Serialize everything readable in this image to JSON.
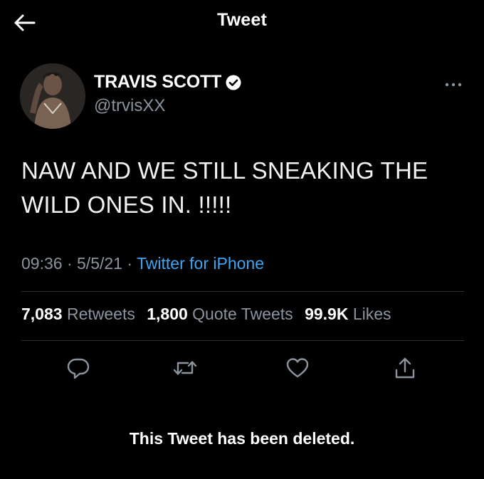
{
  "header": {
    "title": "Tweet"
  },
  "author": {
    "name": "TRAVIS SCOTT",
    "handle": "@trvisXX"
  },
  "tweet": {
    "text_line1": "NAW AND WE STILL SNEAKING THE",
    "text_line2": "WILD ONES IN. !!!!!",
    "time": "09:36",
    "date": "5/5/21",
    "source": "Twitter for iPhone",
    "separator": "·"
  },
  "stats": {
    "retweets_count": "7,083",
    "retweets_label": "Retweets",
    "quotes_count": "1,800",
    "quotes_label": "Quote Tweets",
    "likes_count": "99.9K",
    "likes_label": "Likes"
  },
  "status": {
    "deleted": "This Tweet has been deleted."
  },
  "colors": {
    "background": "#000000",
    "muted": "#8b949e",
    "link": "#3ea6f4",
    "divider": "#2c2f33"
  },
  "icons": [
    "back-arrow-icon",
    "verified-icon",
    "more-icon",
    "reply-icon",
    "retweet-icon",
    "like-icon",
    "share-icon"
  ]
}
